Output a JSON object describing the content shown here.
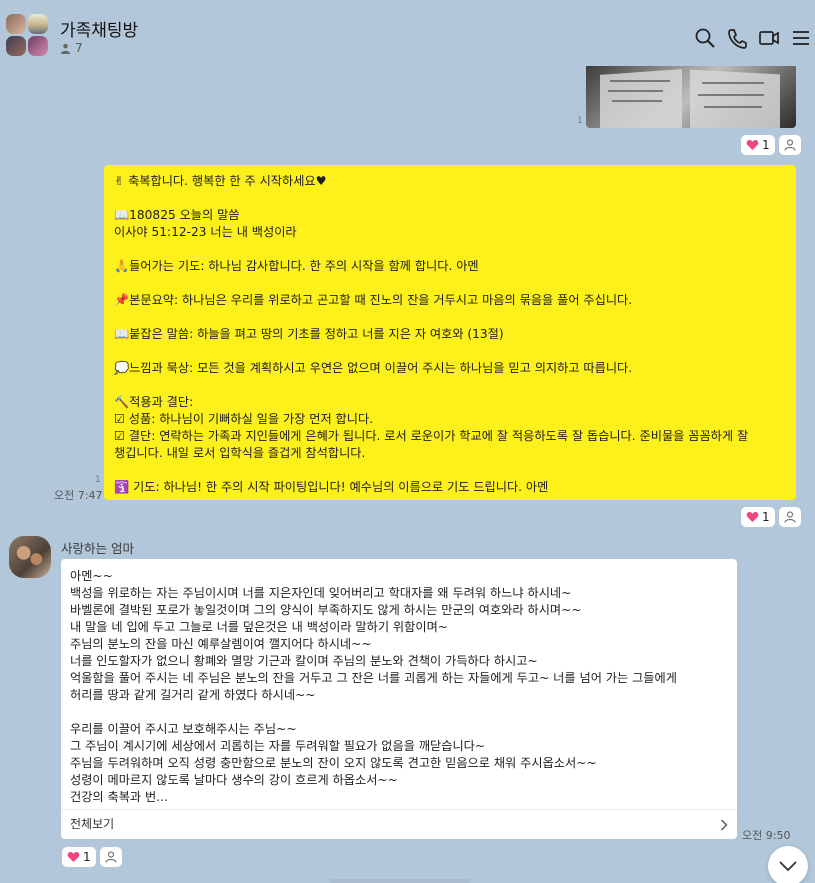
{
  "header": {
    "title": "가족채팅방",
    "member_count": "7",
    "icons": [
      "search-icon",
      "phone-icon",
      "video-icon",
      "menu-icon"
    ]
  },
  "photo_message": {
    "read_marker": "1"
  },
  "reactions_1": {
    "heart_count": "1"
  },
  "yellow_message": {
    "lines": [
      "✌ 축복합니다. 행복한 한 주 시작하세요♥",
      "",
      "📖180825 오늘의 말씀",
      "이사야 51:12-23 너는 내 백성이라",
      "",
      "🙏들어가는 기도: 하나님 감사합니다. 한 주의 시작을 함께 합니다. 아멘",
      "",
      "📌본문요약: 하나님은 우리를 위로하고 곤고할 때 진노의 잔을 거두시고 마음의 묶음을 풀어 주십니다.",
      "",
      "📖붙잡은 말씀: 하늘을 펴고 땅의 기초를 정하고 너를 지은 자 여호와 (13절)",
      "",
      "💭느낌과 묵상: 모든 것을 계획하시고 우연은 없으며 이끌어 주시는 하나님을 믿고 의지하고 따릅니다.",
      "",
      "🔨적용과 결단:",
      "☑ 성품: 하나님이 기뻐하실 일을 가장 먼저 합니다.",
      "☑ 결단: 연락하는 가족과 지인들에게 은혜가 됩니다. 로서 로운이가 학교에 잘 적응하도록 잘 돕습니다. 준비물을 꼼꼼하게 잘",
      "  챙깁니다. 내일 로서 입학식을 즐겁게 참석합니다.",
      "",
      "🛐 기도: 하나님! 한 주의 시작 파이팅입니다! 예수님의 이름으로 기도 드립니다. 아멘"
    ],
    "read_marker": "1",
    "time": "오전 7:47"
  },
  "reactions_2": {
    "heart_count": "1"
  },
  "received_message": {
    "sender": "사랑하는 엄마",
    "lines": [
      "아멘~~",
      "백성을 위로하는 자는 주님이시며 너를 지은자인데 잊어버리고 학대자를 왜 두려워 하느냐 하시네~",
      "바벨론에 결박된 포로가 놓일것이며 그의 양식이 부족하지도 않게 하시는 만군의 여호와라 하시며~~",
      "내 말을 네 입에 두고 그늘로 너를 덮은것은 내 백성이라 말하기 위함이며~",
      "주님의 분노의 잔을 마신 예루살렘이여 깰지어다 하시네~~",
      "너를  인도할자가 없으니 황폐와 멸망 기근과 칼이며 주님의 분노와 견책이 가득하다 하시고~",
      "억울함을 풀어 주시는 네 주님은 분노의 잔을 거두고 그 잔은 너를 괴롭게 하는 자들에게 두고~ 너를 넘어 가는 그들에게",
      "허리를 땅과 같게 길거리 같게 하였다 하시네~~",
      "",
      "우리를 이끌어 주시고 보호해주시는 주님~~",
      "그 주님이 계시기에 세상에서 괴롭히는 자를 두려워할 필요가 없음을 깨닫습니다~",
      "주님을 두려워하며 오직 성령 충만함으로 분노의 잔이 오지 않도록 견고한 믿음으로 채워 주시옵소서~~",
      "성령이 메마르지 않도록 날마다 생수의 강이 흐르게 하옵소서~~",
      "건강의 축복과 번..."
    ],
    "see_all": "전체보기",
    "time": "오전 9:50"
  },
  "reactions_3": {
    "heart_count": "1"
  }
}
